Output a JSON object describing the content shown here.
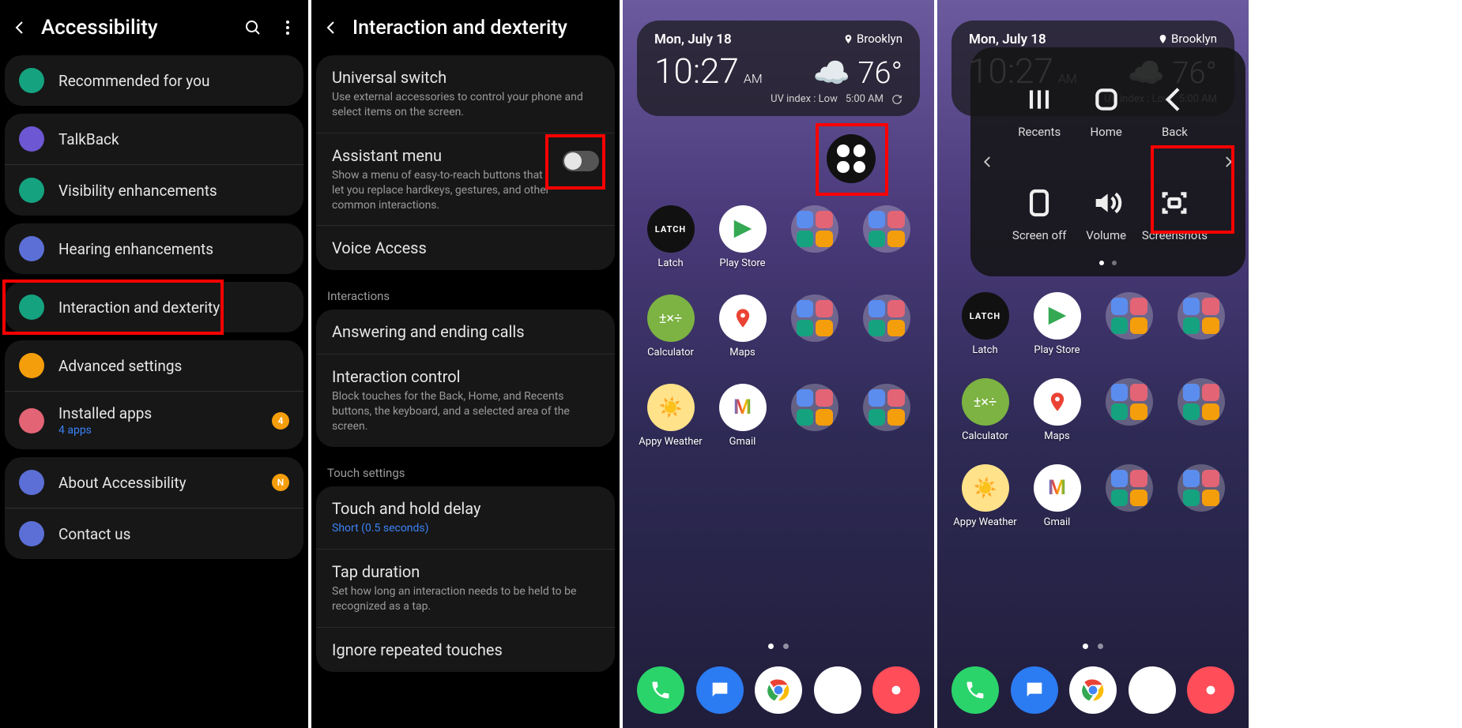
{
  "panel1": {
    "title": "Accessibility",
    "rows": [
      {
        "icon": "star",
        "color": "#15a37f",
        "title": "Recommended for you"
      },
      {
        "icon": "chat",
        "color": "#6d57d3",
        "title": "TalkBack"
      },
      {
        "icon": "zoom",
        "color": "#15a37f",
        "title": "Visibility enhancements"
      },
      {
        "icon": "ear",
        "color": "#5b6fd6",
        "title": "Hearing enhancements"
      },
      {
        "icon": "touch",
        "color": "#15a37f",
        "title": "Interaction and dexterity"
      },
      {
        "icon": "gear",
        "color": "#f59e0b",
        "title": "Advanced settings"
      },
      {
        "icon": "download",
        "color": "#e36475",
        "title": "Installed apps",
        "sub": "4 apps",
        "badge": "4"
      },
      {
        "icon": "info",
        "color": "#5b6fd6",
        "title": "About Accessibility",
        "badge": "N"
      },
      {
        "icon": "help",
        "color": "#5b6fd6",
        "title": "Contact us"
      }
    ],
    "highlight_row_index": 4
  },
  "panel2": {
    "title": "Interaction and dexterity",
    "groups": [
      {
        "label": null,
        "items": [
          {
            "title": "Universal switch",
            "desc": "Use external accessories to control your phone and select items on the screen."
          },
          {
            "title": "Assistant menu",
            "desc": "Show a menu of easy-to-reach buttons that let you replace hardkeys, gestures, and other common interactions.",
            "toggle": false,
            "highlighted_toggle": true
          },
          {
            "title": "Voice Access"
          }
        ]
      },
      {
        "label": "Interactions",
        "items": [
          {
            "title": "Answering and ending calls"
          },
          {
            "title": "Interaction control",
            "desc": "Block touches for the Back, Home, and Recents buttons, the keyboard, and a selected area of the screen."
          }
        ]
      },
      {
        "label": "Touch settings",
        "items": [
          {
            "title": "Touch and hold delay",
            "sub": "Short (0.5 seconds)"
          },
          {
            "title": "Tap duration",
            "desc": "Set how long an interaction needs to be held to be recognized as a tap."
          },
          {
            "title": "Ignore repeated touches"
          }
        ]
      }
    ]
  },
  "home": {
    "date": "Mon, July 18",
    "time": "10:27",
    "ampm": "AM",
    "location": "Brooklyn",
    "temp": "76°",
    "uv_label": "UV index : Low",
    "sun_time": "5:00 AM",
    "apps_row1": [
      "Latch",
      "Play Store",
      "",
      ""
    ],
    "apps_row2": [
      "Calculator",
      "Maps",
      "",
      ""
    ],
    "apps_row3": [
      "Appy Weather",
      "Gmail",
      "",
      ""
    ],
    "assistant_menu_items": [
      {
        "label": "Recents",
        "glyph": "recents"
      },
      {
        "label": "Home",
        "glyph": "home"
      },
      {
        "label": "Back",
        "glyph": "back"
      },
      {
        "label": "Screen off",
        "glyph": "screenoff"
      },
      {
        "label": "Volume",
        "glyph": "volume"
      },
      {
        "label": "Screenshots",
        "glyph": "screenshot"
      }
    ]
  }
}
